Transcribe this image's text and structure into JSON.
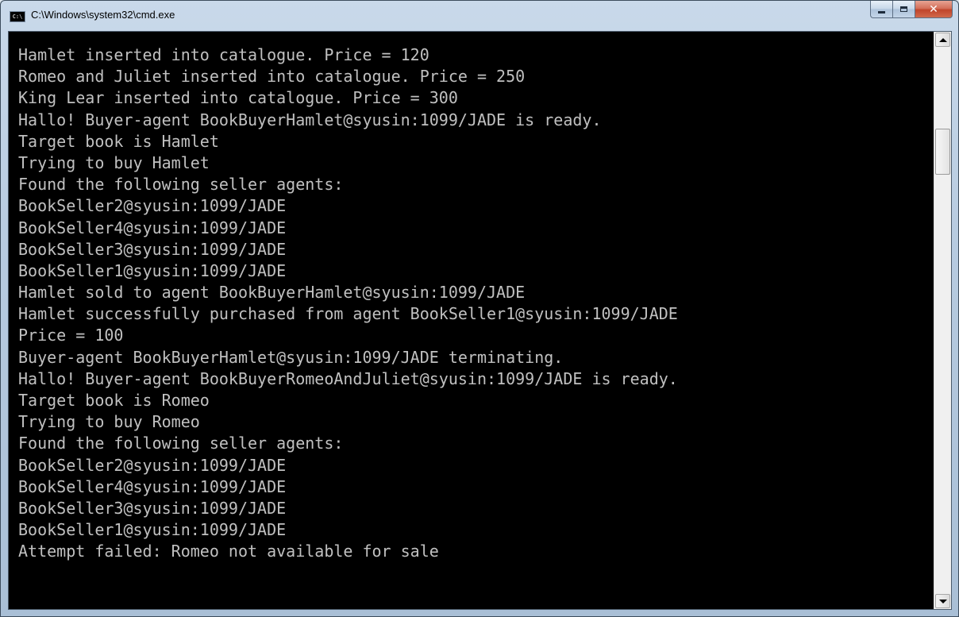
{
  "window": {
    "title": "C:\\Windows\\system32\\cmd.exe",
    "icon_label": "C:\\"
  },
  "console": {
    "lines": [
      "Hamlet inserted into catalogue. Price = 120",
      "Romeo and Juliet inserted into catalogue. Price = 250",
      "King Lear inserted into catalogue. Price = 300",
      "Hallo! Buyer-agent BookBuyerHamlet@syusin:1099/JADE is ready.",
      "Target book is Hamlet",
      "Trying to buy Hamlet",
      "Found the following seller agents:",
      "BookSeller2@syusin:1099/JADE",
      "BookSeller4@syusin:1099/JADE",
      "BookSeller3@syusin:1099/JADE",
      "BookSeller1@syusin:1099/JADE",
      "Hamlet sold to agent BookBuyerHamlet@syusin:1099/JADE",
      "Hamlet successfully purchased from agent BookSeller1@syusin:1099/JADE",
      "Price = 100",
      "Buyer-agent BookBuyerHamlet@syusin:1099/JADE terminating.",
      "Hallo! Buyer-agent BookBuyerRomeoAndJuliet@syusin:1099/JADE is ready.",
      "Target book is Romeo",
      "Trying to buy Romeo",
      "Found the following seller agents:",
      "BookSeller2@syusin:1099/JADE",
      "BookSeller4@syusin:1099/JADE",
      "BookSeller3@syusin:1099/JADE",
      "BookSeller1@syusin:1099/JADE",
      "Attempt failed: Romeo not available for sale"
    ]
  },
  "icons": {
    "app": "cmd-icon",
    "minimize": "minimize-icon",
    "maximize": "maximize-icon",
    "close": "close-icon",
    "scroll_up": "arrow-up-icon",
    "scroll_down": "arrow-down-icon"
  },
  "colors": {
    "console_bg": "#000000",
    "console_fg": "#c0c0c0",
    "close_button": "#c0452b"
  }
}
